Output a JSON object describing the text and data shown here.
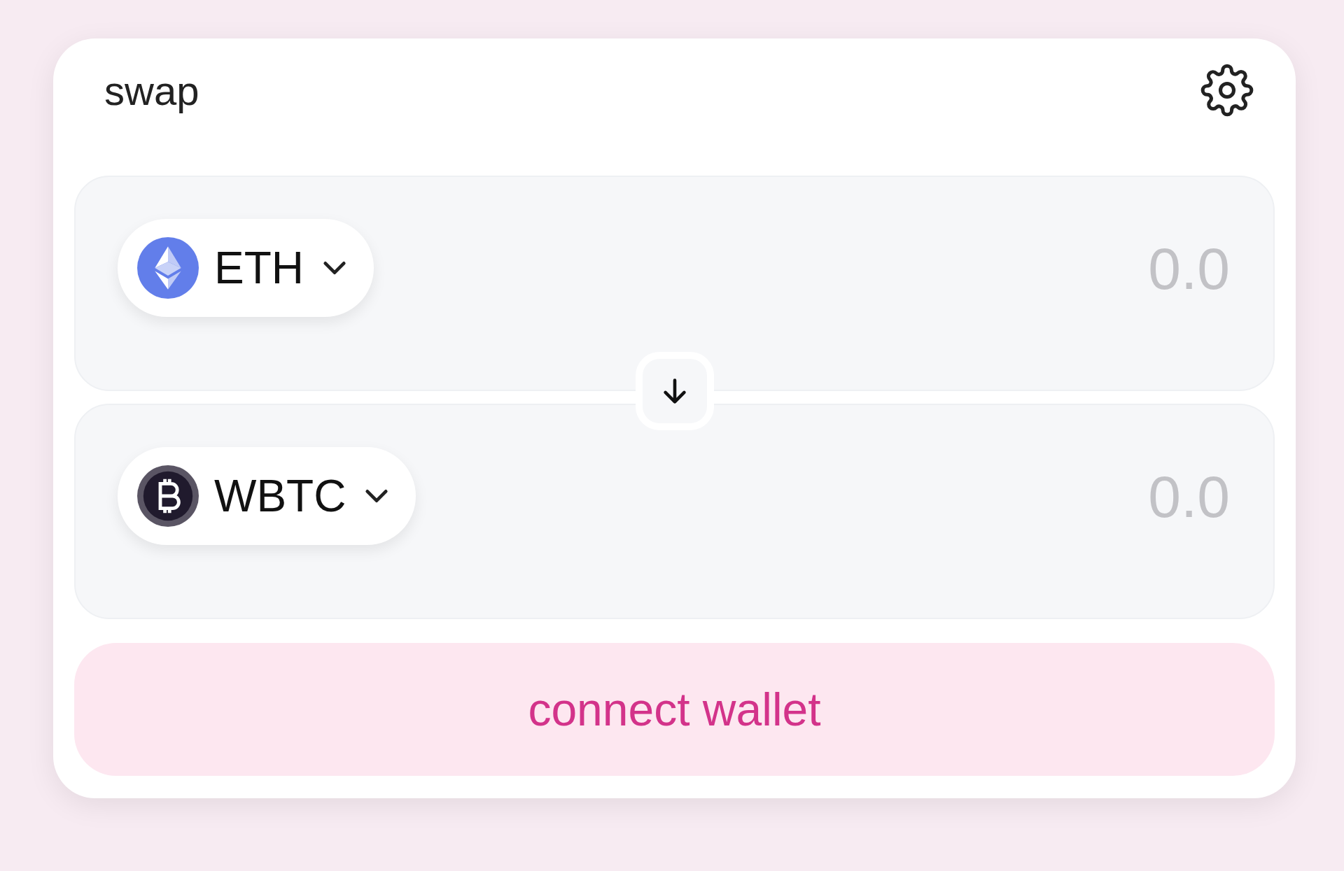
{
  "header": {
    "title": "swap"
  },
  "inputs": [
    {
      "token": {
        "symbol": "ETH",
        "kind": "eth"
      },
      "placeholder": "0.0"
    },
    {
      "token": {
        "symbol": "WBTC",
        "kind": "wbtc"
      },
      "placeholder": "0.0"
    }
  ],
  "connect_button": "connect wallet"
}
